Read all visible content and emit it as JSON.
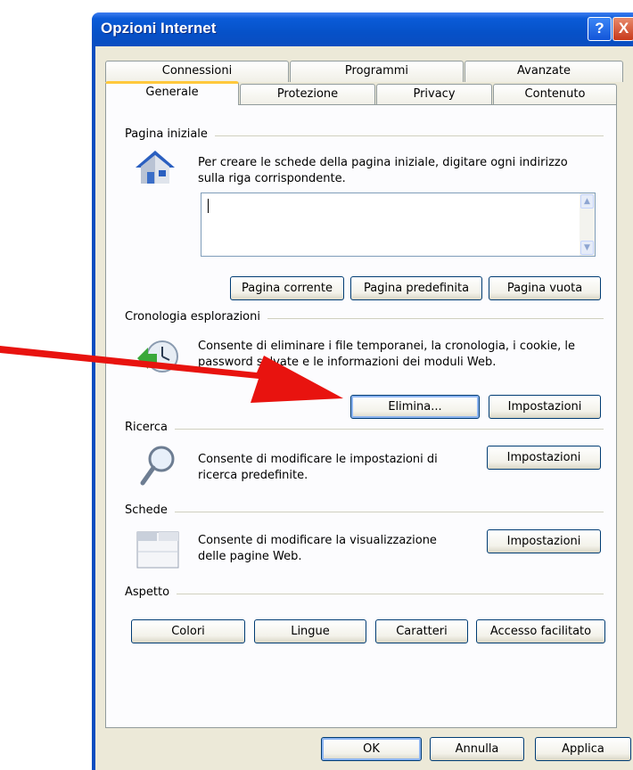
{
  "window": {
    "title": "Opzioni Internet",
    "help_button": "?",
    "close_button": "X"
  },
  "tabs": {
    "row1": [
      "Connessioni",
      "Programmi",
      "Avanzate"
    ],
    "row2": [
      "Generale",
      "Protezione",
      "Privacy",
      "Contenuto"
    ],
    "active": "Generale"
  },
  "home_page": {
    "section_label": "Pagina iniziale",
    "description_line1": "Per creare le schede della pagina iniziale, digitare ogni indirizzo",
    "description_line2": "sulla riga corrispondente.",
    "textarea_value": "",
    "buttons": {
      "current": "Pagina corrente",
      "default": "Pagina predefinita",
      "blank": "Pagina vuota"
    }
  },
  "history": {
    "section_label": "Cronologia esplorazioni",
    "description_line1": "Consente di eliminare i file temporanei, la cronologia, i cookie, le",
    "description_line2": "password salvate e le informazioni dei moduli Web.",
    "delete_button": "Elimina...",
    "settings_button": "Impostazioni"
  },
  "search": {
    "section_label": "Ricerca",
    "description_line1": "Consente di modificare le impostazioni di",
    "description_line2": "ricerca predefinite.",
    "settings_button": "Impostazioni"
  },
  "tabs_section": {
    "section_label": "Schede",
    "description_line1": "Consente di modificare la visualizzazione",
    "description_line2": "delle pagine Web.",
    "settings_button": "Impostazioni"
  },
  "appearance": {
    "section_label": "Aspetto",
    "buttons": {
      "colors": "Colori",
      "languages": "Lingue",
      "fonts": "Caratteri",
      "accessibility": "Accesso facilitato"
    }
  },
  "footer": {
    "ok": "OK",
    "cancel": "Annulla",
    "apply": "Applica"
  },
  "annotation": {
    "arrow_color": "#e8130f",
    "points_to": "delete-button"
  },
  "colors": {
    "titlebar": "#0651c8",
    "dialog_bg": "#ece9d8",
    "panel_bg": "#fcfcfe",
    "active_tab_accent": "#ffc83c",
    "button_border": "#003c74"
  }
}
